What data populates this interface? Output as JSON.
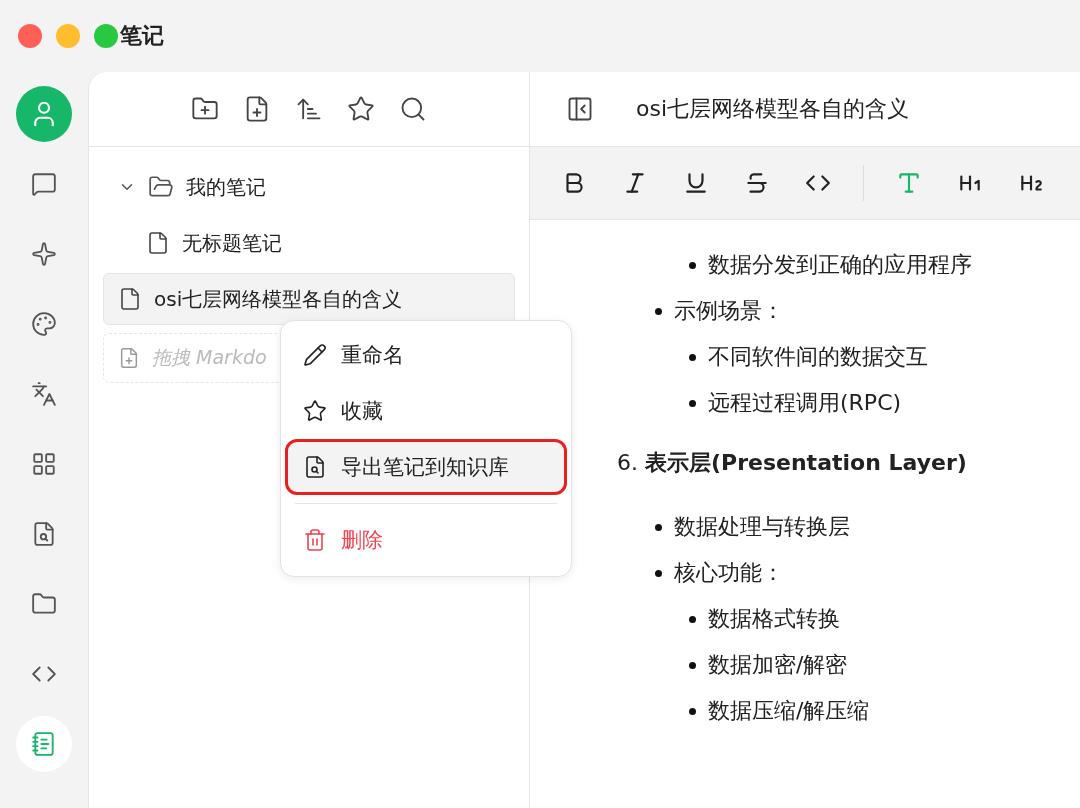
{
  "window": {
    "title": "笔记"
  },
  "rail": [
    {
      "selected": false
    },
    {
      "selected": false
    },
    {
      "selected": false
    },
    {
      "selected": false
    },
    {
      "selected": false
    },
    {
      "selected": false
    },
    {
      "selected": false
    },
    {
      "selected": false
    },
    {
      "selected": true
    }
  ],
  "tree": [
    {
      "kind": "folder",
      "label": "我的笔记",
      "expanded": true,
      "selected": false,
      "children": [
        {
          "kind": "note",
          "label": "无标题笔记",
          "selected": false
        }
      ]
    },
    {
      "kind": "note",
      "label": "osi七层网络模型各自的含义",
      "selected": true
    }
  ],
  "dropzone": {
    "placeholder": "拖拽 Markdo"
  },
  "context_menu": [
    {
      "kind": "normal",
      "label": "重命名",
      "selected": false,
      "outlined": false
    },
    {
      "kind": "normal",
      "label": "收藏",
      "selected": false,
      "outlined": false
    },
    {
      "kind": "normal",
      "label": "导出笔记到知识库",
      "selected": true,
      "outlined": true
    },
    {
      "kind": "danger",
      "label": "删除",
      "selected": false,
      "outlined": false
    }
  ],
  "editor": {
    "title": "osi七层网络模型各自的含义",
    "toolbar": [
      {
        "active": false
      },
      {
        "active": false
      },
      {
        "active": false
      },
      {
        "active": false
      },
      {
        "active": false
      },
      {
        "active": true
      },
      {
        "active": false
      },
      {
        "active": false
      }
    ],
    "blocks": [
      {
        "kind": "list",
        "items": [
          {
            "children": [
              {
                "text": "数据分发到正确的应用程序"
              }
            ]
          },
          {
            "text": "示例场景：",
            "children": [
              {
                "text": "不同软件间的数据交互"
              },
              {
                "text": "远程过程调用(RPC)"
              }
            ]
          }
        ]
      },
      {
        "kind": "heading",
        "text": "6. **表示层(Presentation Layer)**"
      },
      {
        "kind": "list",
        "items": [
          {
            "text": "数据处理与转换层"
          },
          {
            "text": "核心功能：",
            "children": [
              {
                "text": "数据格式转换"
              },
              {
                "text": "数据加密/解密"
              },
              {
                "text": "数据压缩/解压缩"
              }
            ]
          }
        ]
      }
    ]
  }
}
